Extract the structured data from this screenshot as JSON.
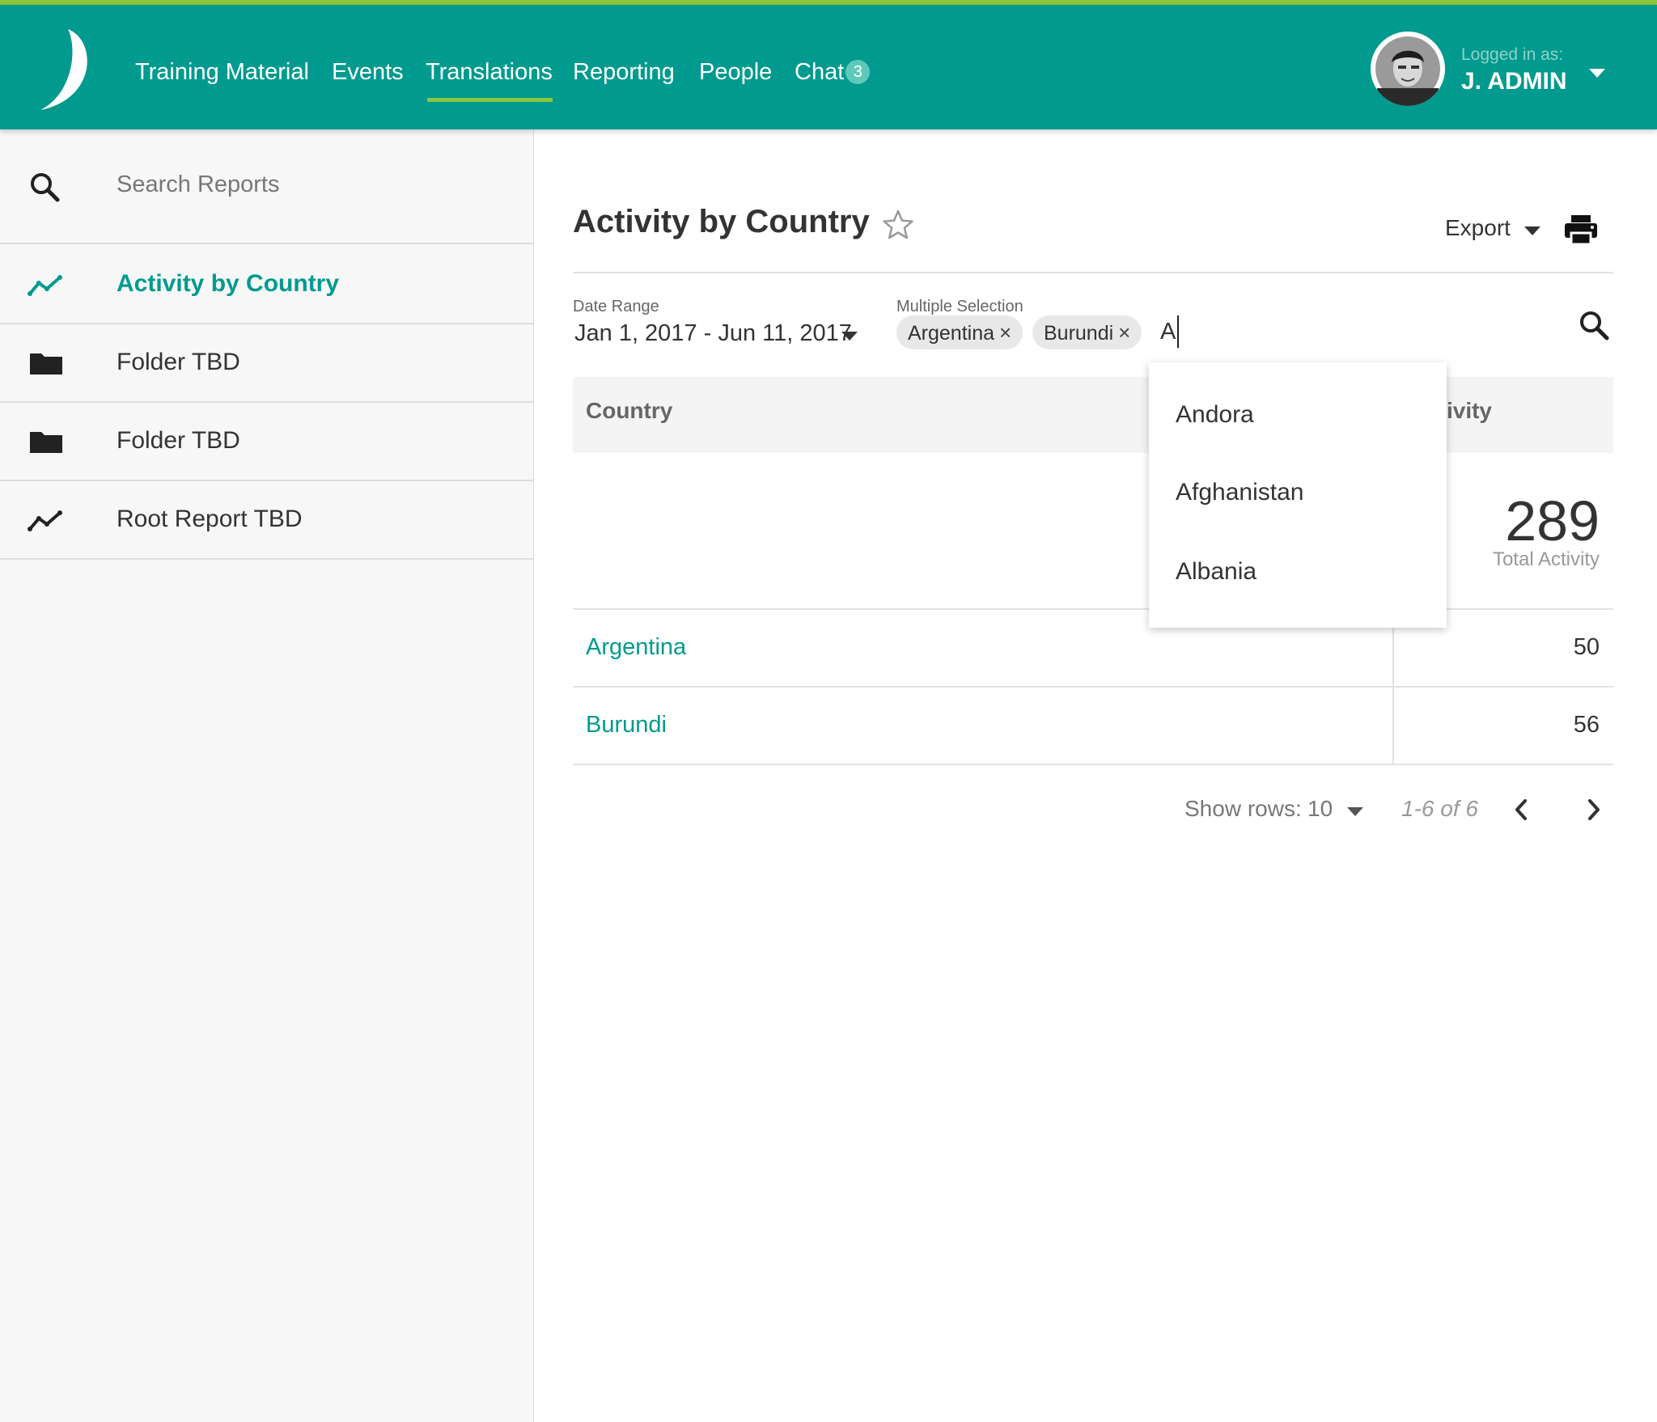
{
  "header": {
    "nav": [
      {
        "label": "Training Material"
      },
      {
        "label": "Events"
      },
      {
        "label": "Translations"
      },
      {
        "label": "Reporting"
      },
      {
        "label": "People"
      },
      {
        "label": "Chat"
      }
    ],
    "chat_badge": "3",
    "logged_in_label": "Logged in as:",
    "user_name": "J. ADMIN",
    "accent_color": "#009a8e",
    "active_underline_color": "#8cc63f"
  },
  "sidebar": {
    "search_placeholder": "Search Reports",
    "items": [
      {
        "label": "Activity by Country",
        "icon": "trend-line-icon",
        "active": true
      },
      {
        "label": "Folder TBD",
        "icon": "folder-icon"
      },
      {
        "label": "Folder TBD",
        "icon": "folder-icon"
      },
      {
        "label": "Root Report TBD",
        "icon": "trend-line-icon"
      }
    ]
  },
  "report": {
    "title": "Activity by Country",
    "export_label": "Export",
    "filters": {
      "date_range_label": "Date Range",
      "date_range_value": "Jan 1, 2017 - Jun 11, 2017",
      "multi_label": "Multiple Selection",
      "chips": [
        "Argentina",
        "Burundi"
      ],
      "chip_remove": "×",
      "typed_value": "A"
    },
    "dropdown_options": [
      "Andora",
      "Afghanistan",
      "Albania"
    ],
    "table": {
      "col_country": "Country",
      "col_activity": "ivity",
      "total_value": "289",
      "total_label": "Total Activity",
      "rows": [
        {
          "country": "Argentina",
          "value": "50"
        },
        {
          "country": "Burundi",
          "value": "56"
        }
      ]
    },
    "pagination": {
      "show_rows_label": "Show rows:",
      "rows_value": "10",
      "range": "1-6 of 6"
    }
  }
}
